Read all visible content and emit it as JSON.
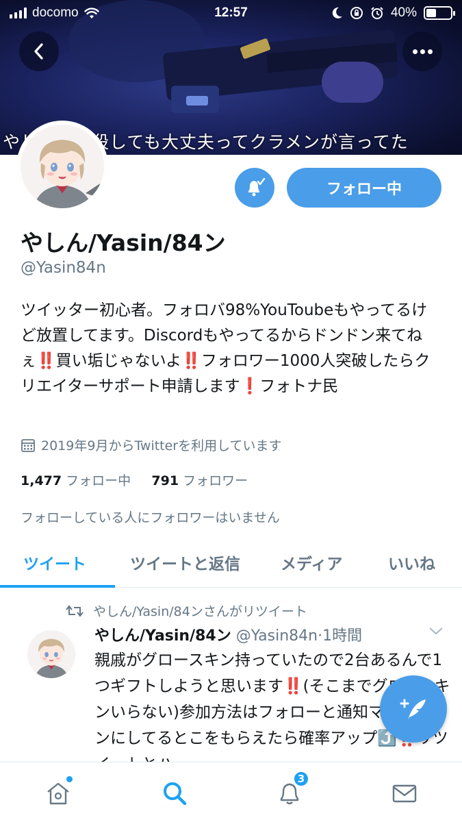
{
  "status_bar": {
    "carrier": "docomo",
    "time": "12:57",
    "battery_percent": "40%",
    "battery_level": 0.4
  },
  "banner": {
    "caption": "やしんなら殺しても大丈夫ってクラメンが言ってた"
  },
  "profile": {
    "name": "やしん/Yasin/84ン",
    "handle": "@Yasin84n",
    "bio": "ツイッター初心者。フォロバ98%YouToubeもやってるけど放置してます。Discordもやってるからドンドン来てねぇ‼️買い垢じゃないよ‼️フォロワー1000人突破したらクリエイターサポート申請します❗️フォトナ民",
    "joined": "2019年9月からTwitterを利用しています",
    "following_count": "1,477",
    "following_label": "フォロー中",
    "followers_count": "791",
    "followers_label": "フォロワー",
    "mutual_note": "フォローしている人にフォロワーはいません",
    "follow_button_label": "フォロー中"
  },
  "tabs": [
    {
      "label": "ツイート",
      "active": true
    },
    {
      "label": "ツイートと返信",
      "active": false
    },
    {
      "label": "メディア",
      "active": false
    },
    {
      "label": "いいね",
      "active": false
    }
  ],
  "tweet": {
    "retweet_note": "やしん/Yasin/84ンさんがリツイート",
    "author_name": "やしん/Yasin/84ン",
    "author_handle": "@Yasin84n",
    "time": "1時間",
    "text": "親戚がグロースキン持っていたので2台あるんで1つギフトしようと思います‼️(そこまでグロースキンいらない)参加方法はフォローと通知マークをオンにしてるとこをもらえたら確率アップ⤴️‼️リツイートとハ"
  },
  "bottom_nav": {
    "notifications_badge": "3"
  },
  "colors": {
    "accent": "#1da1f2",
    "button_blue": "#4a9de8",
    "secondary_text": "#657786"
  },
  "icons": [
    "back-arrow-icon",
    "more-icon",
    "bell-check-icon",
    "calendar-icon",
    "retweet-icon",
    "chevron-down-icon",
    "compose-icon",
    "home-icon",
    "search-icon",
    "notifications-icon",
    "messages-icon"
  ]
}
